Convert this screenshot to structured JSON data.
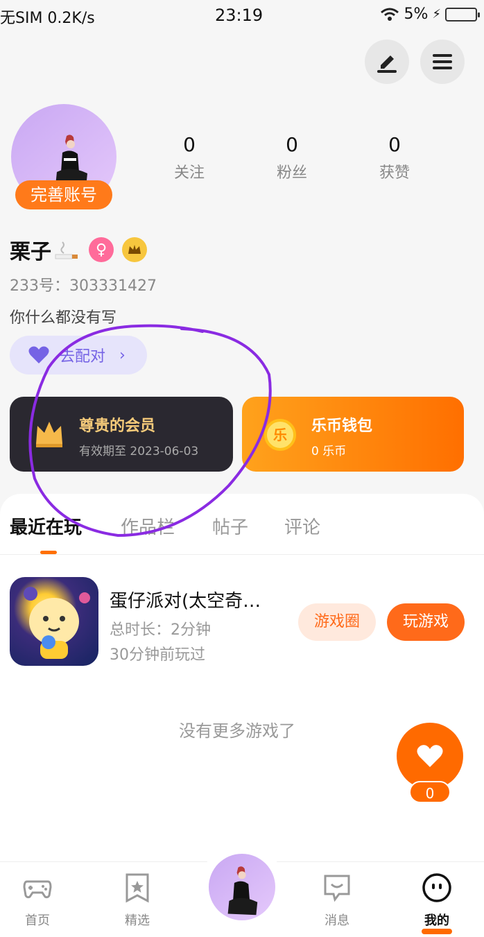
{
  "status_bar": {
    "carrier": "无SIM 0.2K/s",
    "time": "23:19",
    "battery": "5%"
  },
  "profile": {
    "complete_account": "完善账号",
    "stats": [
      {
        "num": "0",
        "label": "关注"
      },
      {
        "num": "0",
        "label": "粉丝"
      },
      {
        "num": "0",
        "label": "获赞"
      }
    ],
    "username": "栗子",
    "uid": "233号：303331427",
    "bio": "你什么都没有写",
    "pair_label": "去配对"
  },
  "cards": {
    "vip_title": "尊贵的会员",
    "vip_sub": "有效期至 2023-06-03",
    "wallet_title": "乐币钱包",
    "wallet_sub": "0 乐币",
    "coin_char": "乐"
  },
  "tabs": [
    "最近在玩",
    "作品栏",
    "帖子",
    "评论"
  ],
  "game": {
    "title": "蛋仔派对(太空奇…",
    "time": "总时长：2分钟",
    "last_played": "30分钟前玩过",
    "circle_btn": "游戏圈",
    "play_btn": "玩游戏"
  },
  "no_more": "没有更多游戏了",
  "like_count": "0",
  "bottom_nav": [
    {
      "label": "首页",
      "icon": "gamepad-icon"
    },
    {
      "label": "精选",
      "icon": "star-bookmark-icon"
    },
    {
      "label": "消息",
      "icon": "message-icon"
    },
    {
      "label": "我的",
      "icon": "face-icon"
    }
  ],
  "colors": {
    "accent": "#ff6a00",
    "vip_gold": "#f6cb7a",
    "pair_purple": "#7563e5",
    "annotation_circle": "#8a2be2"
  }
}
